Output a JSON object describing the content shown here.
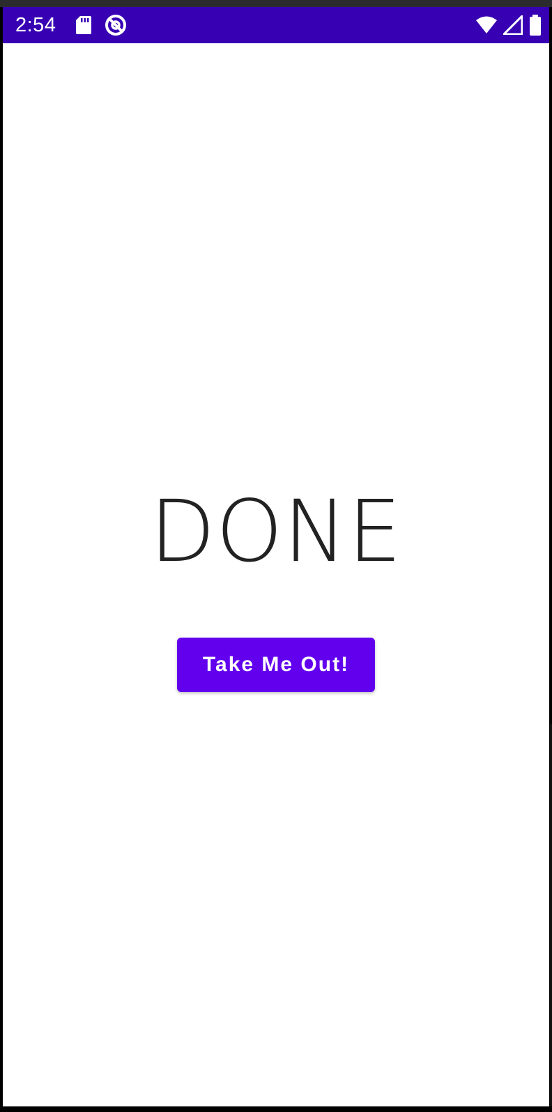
{
  "status_bar": {
    "time": "2:54",
    "background_color": "#3700b3",
    "left_icons": [
      "sd-card-icon",
      "do-not-disturb-icon"
    ],
    "right_icons": [
      "wifi-icon",
      "cellular-signal-icon",
      "battery-icon"
    ]
  },
  "main": {
    "title": "DONE",
    "button_label": "Take Me Out!",
    "button_color": "#6200ee"
  }
}
